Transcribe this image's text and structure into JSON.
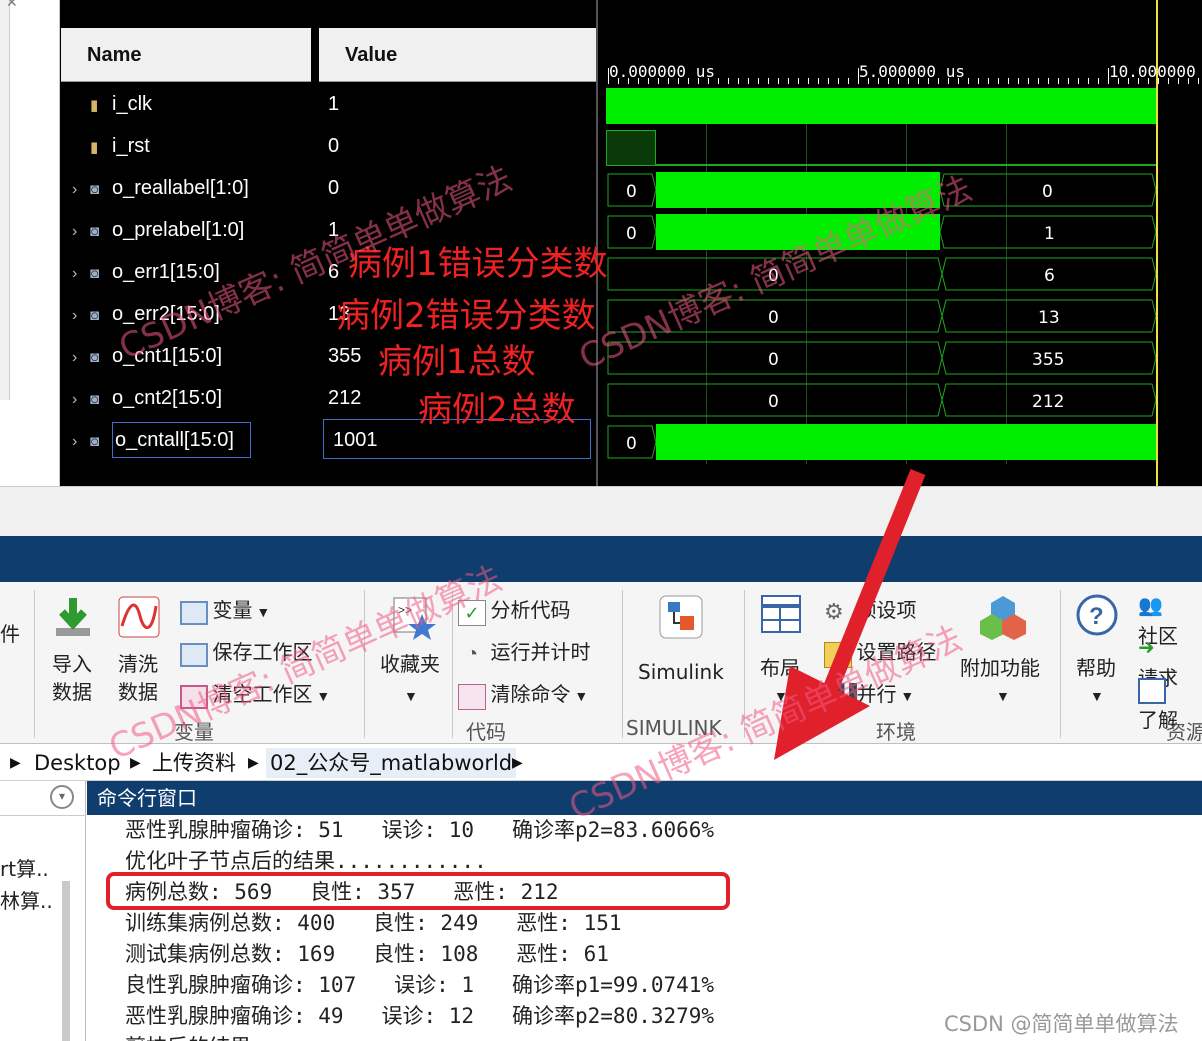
{
  "sim": {
    "headers": {
      "name": "Name",
      "value": "Value"
    },
    "signals": [
      {
        "name": "i_clk",
        "value": "1",
        "bus": false
      },
      {
        "name": "i_rst",
        "value": "0",
        "bus": false
      },
      {
        "name": "o_reallabel[1:0]",
        "value": "0",
        "bus": true
      },
      {
        "name": "o_prelabel[1:0]",
        "value": "1",
        "bus": true
      },
      {
        "name": "o_err1[15:0]",
        "value": "6",
        "bus": true
      },
      {
        "name": "o_err2[15:0]",
        "value": "13",
        "bus": true
      },
      {
        "name": "o_cnt1[15:0]",
        "value": "355",
        "bus": true
      },
      {
        "name": "o_cnt2[15:0]",
        "value": "212",
        "bus": true
      },
      {
        "name": "o_cntall[15:0]",
        "value": "1001",
        "bus": true
      }
    ],
    "ruler": {
      "t0": "0.000000 us",
      "t1": "5.000000 us",
      "t2": "10.000000"
    },
    "wave_labels": {
      "reallabel": [
        "0",
        "0"
      ],
      "prelabel": [
        "0",
        "1"
      ],
      "err1": [
        "0",
        "6"
      ],
      "err2": [
        "0",
        "13"
      ],
      "cnt1": [
        "0",
        "355"
      ],
      "cnt2": [
        "0",
        "212"
      ],
      "cntall": [
        "0"
      ]
    },
    "annotations": {
      "err1": "病例1错误分类数",
      "err2": "病例2错误分类数",
      "cnt1": "病例1总数",
      "cnt2": "病例2总数"
    },
    "colors": {
      "wave": "#00ee00",
      "cursor": "#f0e040"
    }
  },
  "ribbon": {
    "partial_left": "件",
    "import": [
      "导入",
      "数据"
    ],
    "clean": [
      "清洗",
      "数据"
    ],
    "variable": "变量",
    "save_ws": "保存工作区",
    "clear_ws": "清空工作区",
    "section_variable": "变量",
    "favorites": "收藏夹",
    "analyze": "分析代码",
    "run_timed": "运行并计时",
    "clear_cmd": "清除命令",
    "section_code": "代码",
    "simulink": "Simulink",
    "section_simulink": "SIMULINK",
    "layout": "布局",
    "preferences": "预设项",
    "set_path": "设置路径",
    "parallel": "并行",
    "addons": "附加功能",
    "section_env": "环境",
    "help": "帮助",
    "community": "社区",
    "request": "请求",
    "learn": "了解",
    "section_resources": "资源"
  },
  "address": {
    "desktop": "Desktop",
    "upload": "上传资料",
    "folder": "02_公众号_matlabworld"
  },
  "leftpane": {
    "item1": "rt算..",
    "item2": "林算.."
  },
  "cmd": {
    "title": "命令行窗口",
    "lines": [
      "恶性乳腺肿瘤确诊: 51   误诊: 10   确诊率p2=83.6066%",
      "优化叶子节点后的结果............",
      "病例总数: 569   良性: 357   恶性: 212",
      "训练集病例总数: 400   良性: 249   恶性: 151",
      "测试集病例总数: 169   良性: 108   恶性: 61",
      "良性乳腺肿瘤确诊: 107   误诊: 1   确诊率p1=99.0741%",
      "恶性乳腺肿瘤确诊: 49   误诊: 12   确诊率p2=80.3279%",
      "剪枝后的结果..."
    ]
  },
  "watermarks": {
    "blog": "CSDN博客: 简简单单做算法",
    "footer": "CSDN @简简单单做算法"
  }
}
